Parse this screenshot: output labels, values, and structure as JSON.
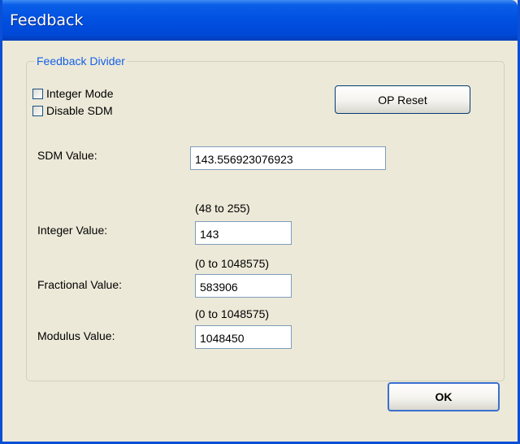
{
  "window": {
    "title": "Feedback"
  },
  "group": {
    "title": "Feedback Divider"
  },
  "checkboxes": {
    "integer_mode": {
      "label": "Integer Mode",
      "checked": false
    },
    "disable_sdm": {
      "label": "Disable SDM",
      "checked": false
    }
  },
  "buttons": {
    "op_reset": "OP Reset",
    "ok": "OK"
  },
  "fields": {
    "sdm": {
      "label": "SDM Value:",
      "value": "143.556923076923"
    },
    "integer": {
      "label": "Integer Value:",
      "range": "(48 to 255)",
      "value": "143"
    },
    "fractional": {
      "label": "Fractional Value:",
      "range": "(0 to 1048575)",
      "value": "583906"
    },
    "modulus": {
      "label": "Modulus Value:",
      "range": "(0 to 1048575)",
      "value": "1048450"
    }
  },
  "colors": {
    "titlebar": "#0050e0",
    "group_title": "#1560e8",
    "dialog_bg": "#ece9d8"
  }
}
